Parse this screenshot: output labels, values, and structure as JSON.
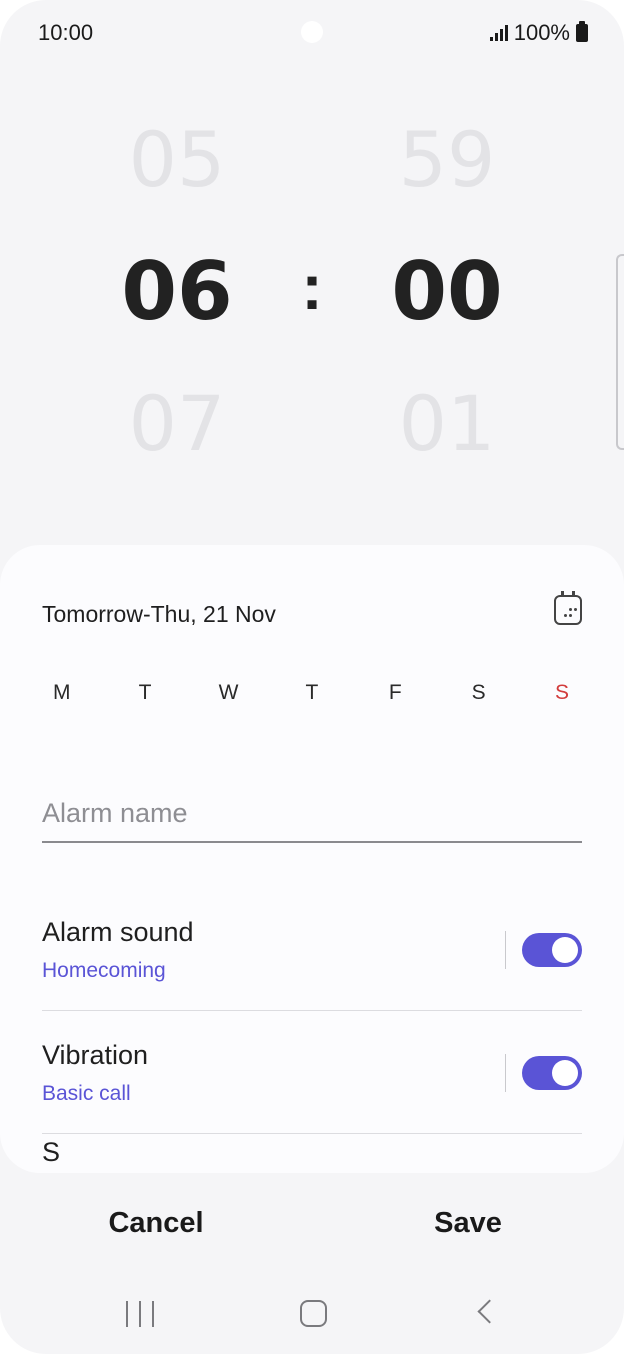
{
  "status_bar": {
    "time": "10:00",
    "battery": "100%",
    "signal_icon": "signal-bars-icon",
    "battery_icon": "battery-full-icon"
  },
  "time_picker": {
    "hours": {
      "prev": "05",
      "current": "06",
      "next": "07"
    },
    "minutes": {
      "prev": "59",
      "current": "00",
      "next": "01"
    },
    "separator": ":"
  },
  "schedule": {
    "date_label": "Tomorrow-Thu, 21 Nov",
    "calendar_icon": "calendar-icon",
    "days": [
      "M",
      "T",
      "W",
      "T",
      "F",
      "S",
      "S"
    ]
  },
  "alarm_name": {
    "placeholder": "Alarm name",
    "value": ""
  },
  "settings": [
    {
      "title": "Alarm sound",
      "subtitle": "Homecoming",
      "enabled": true
    },
    {
      "title": "Vibration",
      "subtitle": "Basic call",
      "enabled": true
    }
  ],
  "peek_row_label": "S",
  "actions": {
    "cancel": "Cancel",
    "save": "Save"
  },
  "colors": {
    "accent": "#5a54d6",
    "sunday": "#d23c3c",
    "background": "#f5f5f7"
  }
}
